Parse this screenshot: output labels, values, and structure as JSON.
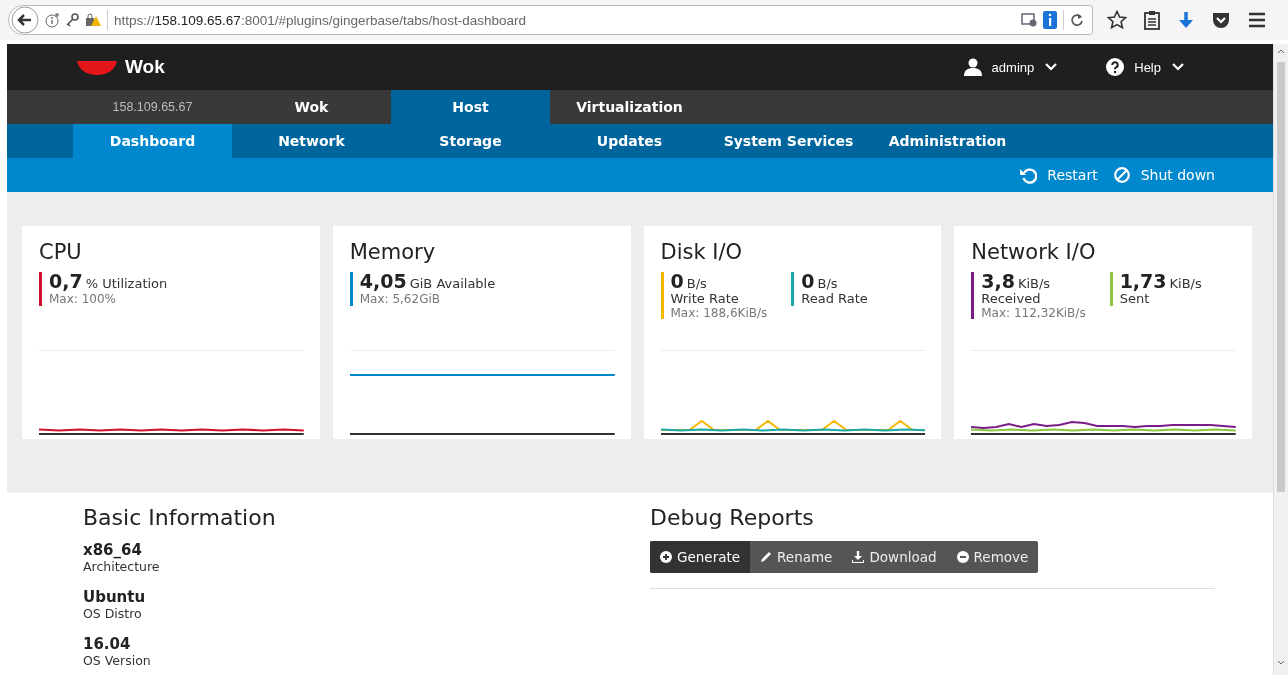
{
  "browser": {
    "url": "https://**158.109.65.67**:8001/#plugins/gingerbase/tabs/host-dashboard"
  },
  "header": {
    "logo": "Wok",
    "user": "adminp",
    "help": "Help"
  },
  "host_address": "158.109.65.67",
  "main_tabs": [
    {
      "label": "Wok",
      "selected": false
    },
    {
      "label": "Host",
      "selected": true
    },
    {
      "label": "Virtualization",
      "selected": false
    }
  ],
  "sub_tabs": [
    {
      "label": "Dashboard",
      "selected": true
    },
    {
      "label": "Network",
      "selected": false
    },
    {
      "label": "Storage",
      "selected": false
    },
    {
      "label": "Updates",
      "selected": false
    },
    {
      "label": "System Services",
      "selected": false
    },
    {
      "label": "Administration",
      "selected": false
    }
  ],
  "actions": [
    {
      "label": "Restart",
      "kind": "restart"
    },
    {
      "label": "Shut down",
      "kind": "shutdown"
    }
  ],
  "cards": [
    {
      "title": "CPU",
      "metrics": [
        {
          "kind": "inline",
          "value": "0,7",
          "unit": "%",
          "label": "Utilization",
          "max": "Max: 100%",
          "color": "#d0112b"
        }
      ]
    },
    {
      "title": "Memory",
      "metrics": [
        {
          "kind": "inline",
          "value": "4,05",
          "unit": "GiB",
          "label": "Available",
          "max": "Max: 5,62GiB",
          "color": "#0088ce"
        }
      ]
    },
    {
      "title": "Disk I/O",
      "metrics": [
        {
          "kind": "stacked",
          "value": "0",
          "unit": "B/s",
          "label": "Write Rate",
          "max": "Max: 188,6KiB/s",
          "color": "#f5b800"
        },
        {
          "kind": "stacked",
          "value": "0",
          "unit": "B/s",
          "label": "Read Rate",
          "color": "#1ca8a8"
        }
      ]
    },
    {
      "title": "Network I/O",
      "metrics": [
        {
          "kind": "stacked",
          "value": "3,8",
          "unit": "KiB/s",
          "label": "Received",
          "max": "Max: 112,32KiB/s",
          "color": "#7b1c86"
        },
        {
          "kind": "stacked",
          "value": "1,73",
          "unit": "KiB/s",
          "label": "Sent",
          "color": "#8cc63f"
        }
      ]
    }
  ],
  "basic_info": {
    "title": "Basic Information",
    "items": [
      {
        "value": "x86_64",
        "label": "Architecture"
      },
      {
        "value": "Ubuntu",
        "label": "OS Distro"
      },
      {
        "value": "16.04",
        "label": "OS Version"
      }
    ]
  },
  "debug_reports": {
    "title": "Debug Reports",
    "buttons": [
      {
        "label": "Generate",
        "kind": "plus",
        "selected": true
      },
      {
        "label": "Rename",
        "kind": "pencil",
        "selected": false
      },
      {
        "label": "Download",
        "kind": "download",
        "selected": false
      },
      {
        "label": "Remove",
        "kind": "minus",
        "selected": false
      }
    ]
  }
}
